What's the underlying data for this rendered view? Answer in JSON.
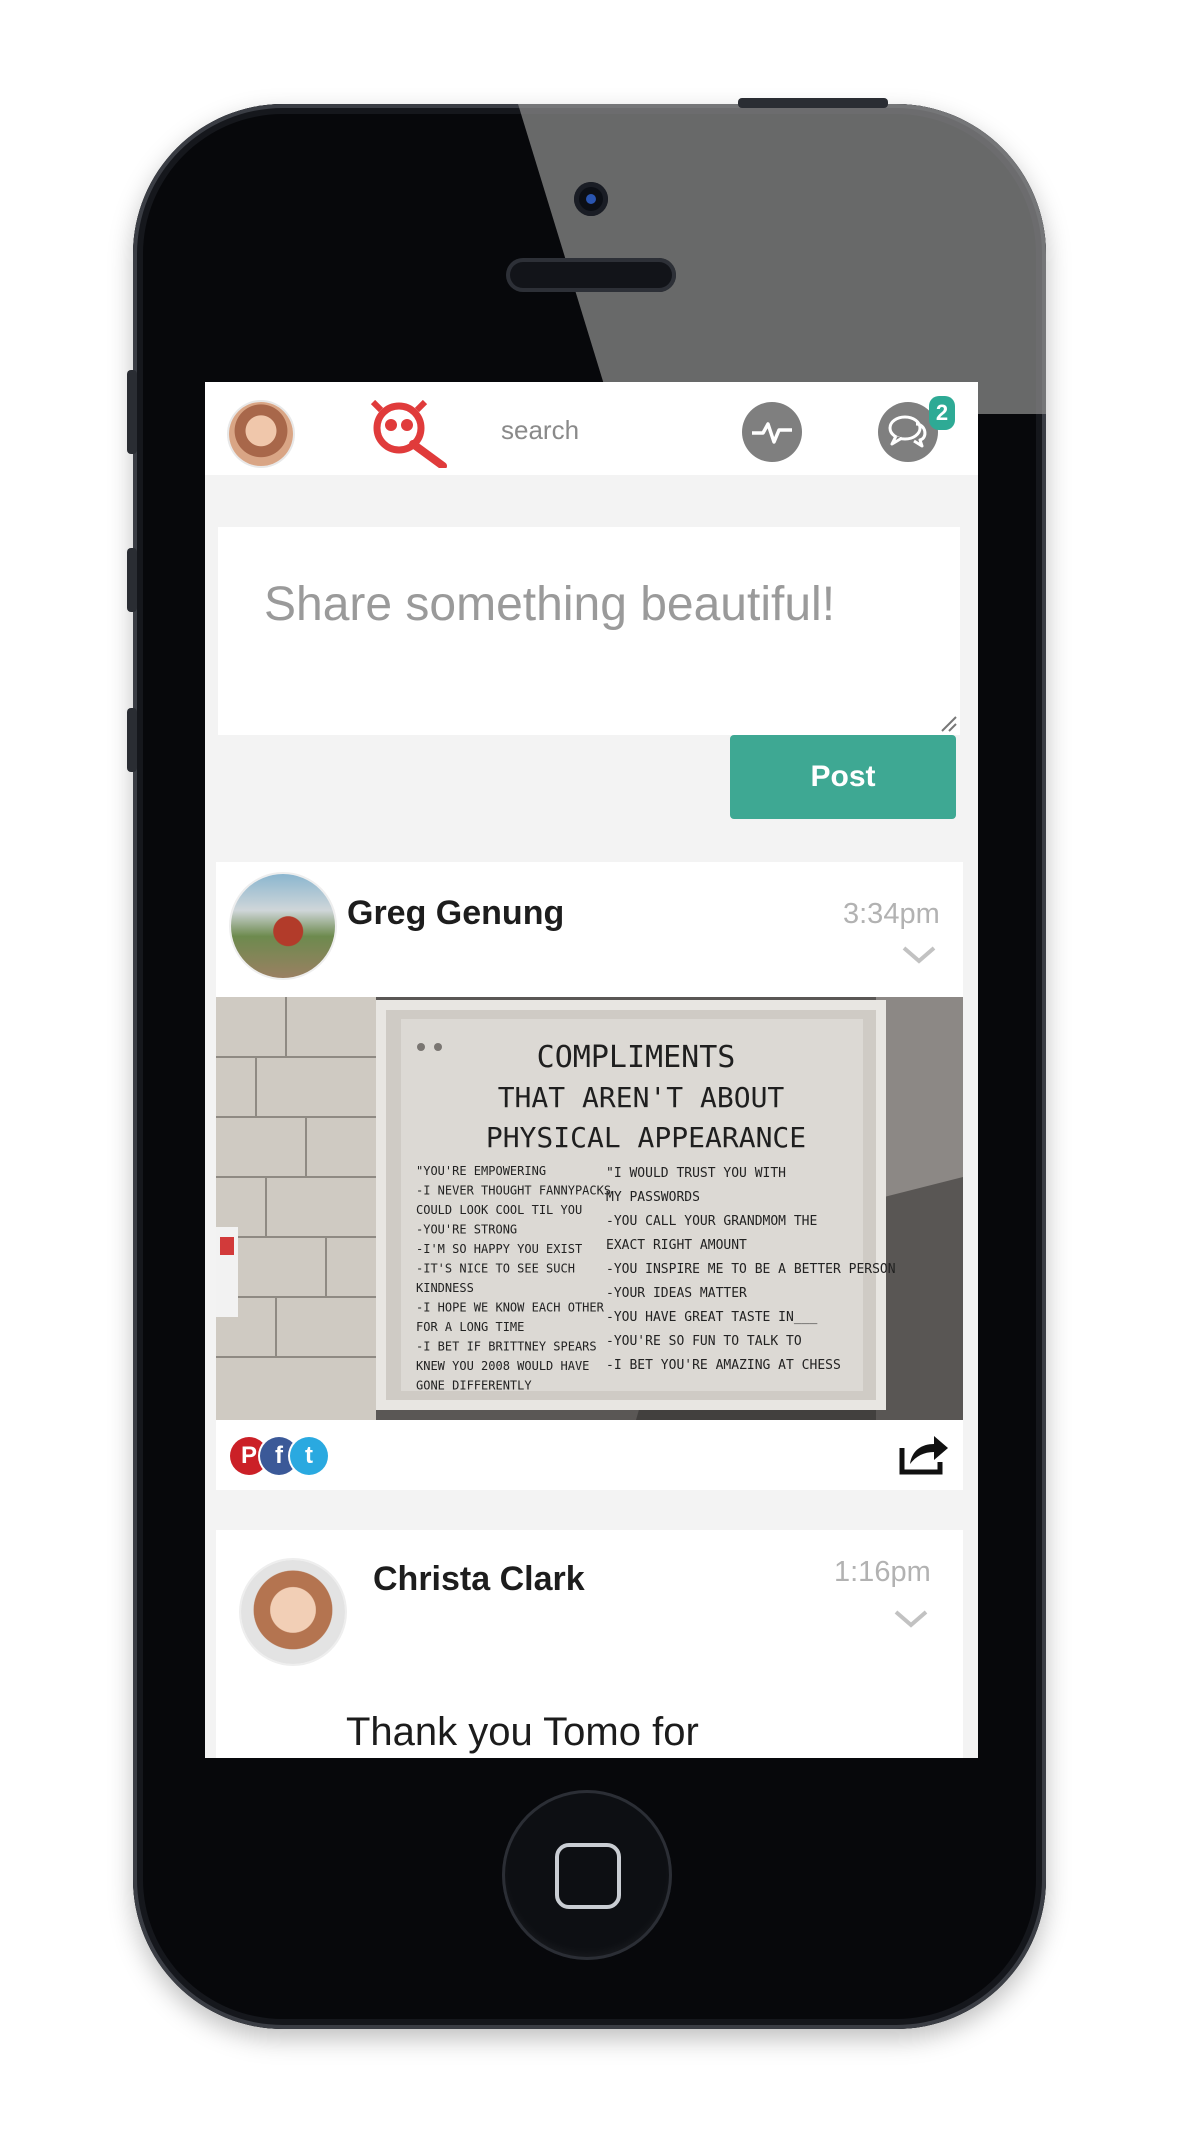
{
  "header": {
    "search_label": "search",
    "messages_badge": "2"
  },
  "composer": {
    "placeholder": "Share something beautiful!",
    "post_label": "Post"
  },
  "posts": [
    {
      "author": "Greg Genung",
      "time": "3:34pm",
      "image": {
        "title_lines": [
          "COMPLIMENTS",
          "THAT AREN'T ABOUT",
          "PHYSICAL APPEARANCE"
        ],
        "left_items": [
          "\"YOU'RE EMPOWERING",
          "-I NEVER THOUGHT FANNYPACKS",
          "COULD LOOK COOL TIL YOU",
          "-YOU'RE STRONG",
          "-I'M SO HAPPY YOU EXIST",
          "-IT'S NICE TO SEE SUCH",
          "KINDNESS",
          "-I HOPE WE KNOW EACH OTHER",
          "FOR A LONG TIME",
          "-I BET IF BRITTNEY SPEARS",
          "KNEW YOU 2008 WOULD HAVE",
          "GONE DIFFERENTLY"
        ],
        "right_items": [
          "\"I WOULD TRUST YOU WITH",
          "MY PASSWORDS",
          "-YOU CALL YOUR GRANDMOM THE",
          "EXACT RIGHT AMOUNT",
          "-YOU INSPIRE ME TO BE A BETTER PERSON",
          "-YOUR IDEAS MATTER",
          "-YOU HAVE GREAT TASTE IN___",
          "-YOU'RE SO FUN TO TALK TO",
          "-I BET YOU'RE AMAZING AT CHESS"
        ]
      },
      "share_icons": [
        "pinterest-icon",
        "facebook-icon",
        "twitter-icon"
      ]
    },
    {
      "author": "Christa Clark",
      "time": "1:16pm",
      "text": "Thank you Tomo for"
    }
  ],
  "colors": {
    "accent": "#3ea893",
    "brand_red": "#e03b3b",
    "badge": "#2eaa95"
  }
}
